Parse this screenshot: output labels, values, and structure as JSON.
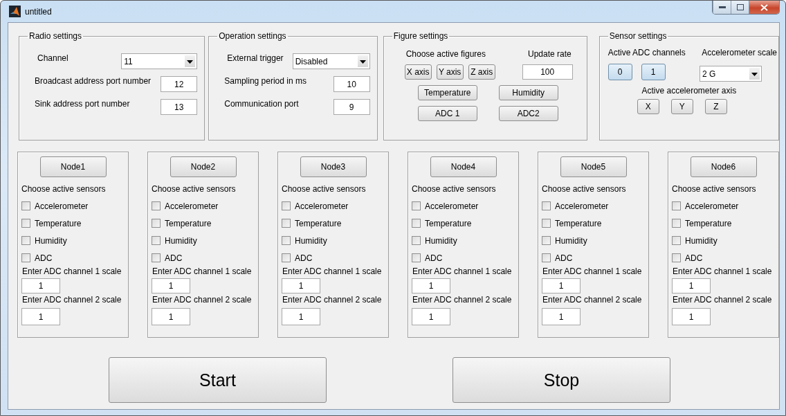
{
  "window": {
    "title": "untitled"
  },
  "radio_settings": {
    "title": "Radio settings",
    "rows": [
      {
        "kind": "dropdown",
        "label": "Channel",
        "value": "11"
      },
      {
        "kind": "field",
        "label": "Broadcast address port number",
        "value": "12"
      },
      {
        "kind": "field",
        "label": "Sink address port number",
        "value": "13"
      }
    ]
  },
  "operation_settings": {
    "title": "Operation settings",
    "rows": [
      {
        "kind": "dropdown",
        "label": "External trigger",
        "value": "Disabled"
      },
      {
        "kind": "field",
        "label": "Sampling period in ms",
        "value": "10"
      },
      {
        "kind": "field",
        "label": "Communication port",
        "value": "9"
      }
    ]
  },
  "figure_settings": {
    "title": "Figure settings",
    "figures_label": "Choose active figures",
    "update_rate_label": "Update rate",
    "update_rate": "100",
    "axis_buttons": [
      {
        "label": "X axis",
        "selected": false
      },
      {
        "label": "Y axis",
        "selected": false
      },
      {
        "label": "Z axis",
        "selected": false
      }
    ],
    "sensor_buttons": [
      {
        "label": "Temperature",
        "selected": false
      },
      {
        "label": "Humidity",
        "selected": false
      },
      {
        "label": "ADC 1",
        "selected": false
      },
      {
        "label": "ADC2",
        "selected": false
      }
    ]
  },
  "sensor_settings": {
    "title": "Sensor settings",
    "adc_label": "Active ADC channels",
    "scale_label": "Accelerometer scale",
    "scale": "2 G",
    "adc_buttons": [
      {
        "label": "0",
        "selected": true
      },
      {
        "label": "1",
        "selected": true
      }
    ],
    "axis_label": "Active accelerometer axis",
    "axis_buttons": [
      {
        "label": "X",
        "selected": false
      },
      {
        "label": "Y",
        "selected": false
      },
      {
        "label": "Z",
        "selected": false
      }
    ]
  },
  "nodes": [
    {
      "button": "Node1",
      "prompt": "Choose active sensors",
      "sensors": [
        {
          "label": "Accelerometer",
          "checked": false
        },
        {
          "label": "Temperature",
          "checked": false
        },
        {
          "label": "Humidity",
          "checked": false
        },
        {
          "label": "ADC",
          "checked": false
        }
      ],
      "scale1_label": "Enter ADC channel 1 scale",
      "scale1": "1",
      "scale2_label": "Enter ADC channel 2 scale",
      "scale2": "1"
    },
    {
      "button": "Node2",
      "prompt": "Choose active sensors",
      "sensors": [
        {
          "label": "Accelerometer",
          "checked": false
        },
        {
          "label": "Temperature",
          "checked": false
        },
        {
          "label": "Humidity",
          "checked": false
        },
        {
          "label": "ADC",
          "checked": false
        }
      ],
      "scale1_label": "Enter ADC channel 1 scale",
      "scale1": "1",
      "scale2_label": "Enter ADC channel 2 scale",
      "scale2": "1"
    },
    {
      "button": "Node3",
      "prompt": "Choose active sensors",
      "sensors": [
        {
          "label": "Accelerometer",
          "checked": false
        },
        {
          "label": "Temperature",
          "checked": false
        },
        {
          "label": "Humidity",
          "checked": false
        },
        {
          "label": "ADC",
          "checked": false
        }
      ],
      "scale1_label": "Enter ADC channel 1 scale",
      "scale1": "1",
      "scale2_label": "Enter ADC channel 2 scale",
      "scale2": "1"
    },
    {
      "button": "Node4",
      "prompt": "Choose active sensors",
      "sensors": [
        {
          "label": "Accelerometer",
          "checked": false
        },
        {
          "label": "Temperature",
          "checked": false
        },
        {
          "label": "Humidity",
          "checked": false
        },
        {
          "label": "ADC",
          "checked": false
        }
      ],
      "scale1_label": "Enter ADC channel 1 scale",
      "scale1": "1",
      "scale2_label": "Enter ADC channel 2 scale",
      "scale2": "1"
    },
    {
      "button": "Node5",
      "prompt": "Choose active sensors",
      "sensors": [
        {
          "label": "Accelerometer",
          "checked": false
        },
        {
          "label": "Temperature",
          "checked": false
        },
        {
          "label": "Humidity",
          "checked": false
        },
        {
          "label": "ADC",
          "checked": false
        }
      ],
      "scale1_label": "Enter ADC channel 1 scale",
      "scale1": "1",
      "scale2_label": "Enter ADC channel 2 scale",
      "scale2": "1"
    },
    {
      "button": "Node6",
      "prompt": "Choose active sensors",
      "sensors": [
        {
          "label": "Accelerometer",
          "checked": false
        },
        {
          "label": "Temperature",
          "checked": false
        },
        {
          "label": "Humidity",
          "checked": false
        },
        {
          "label": "ADC",
          "checked": false
        }
      ],
      "scale1_label": "Enter ADC channel 1 scale",
      "scale1": "1",
      "scale2_label": "Enter ADC channel 2 scale",
      "scale2": "1"
    }
  ],
  "actions": [
    {
      "label": "Start"
    },
    {
      "label": "Stop"
    }
  ]
}
